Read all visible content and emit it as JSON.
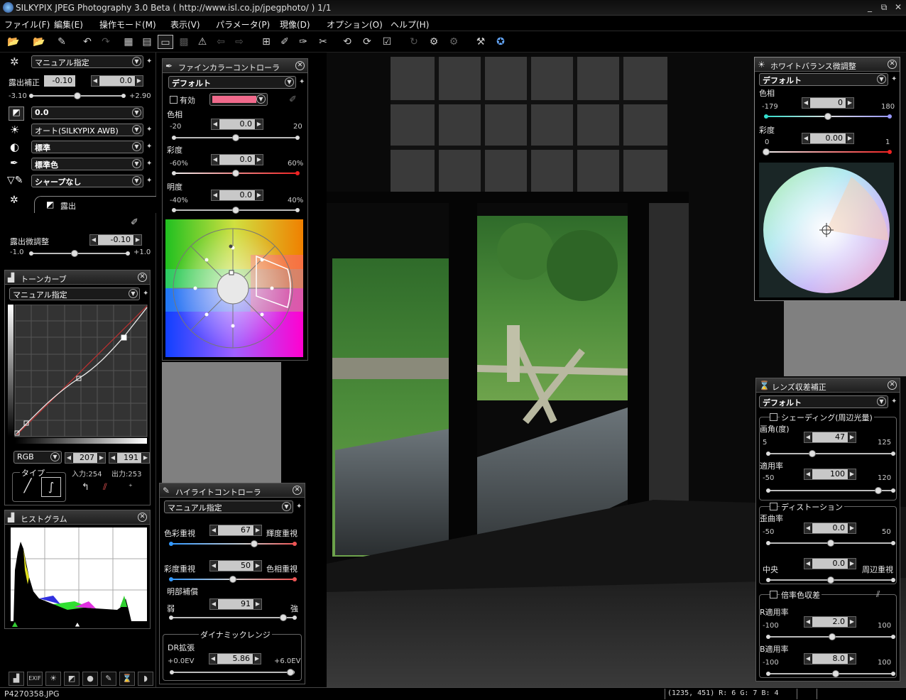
{
  "titlebar": {
    "title": "SILKYPIX JPEG Photography 3.0 Beta ( http://www.isl.co.jp/jpegphoto/ )  1/1",
    "minimize": "_",
    "restore": "⧉",
    "close": "✕"
  },
  "menu": [
    "ファイル(F)",
    "編集(E)",
    "操作モード(M)",
    "表示(V)",
    "パラメータ(P)",
    "現像(D)",
    "オプション(O)",
    "ヘルプ(H)"
  ],
  "toolbar_icons": [
    "open-folder-icon",
    "open-folder-dropdown-icon",
    "eraser-icon",
    "undo-icon",
    "redo-icon",
    "grid-view-icon",
    "filmstrip-view-icon",
    "single-view-icon",
    "compare-view-icon",
    "warning-icon",
    "prev-icon",
    "next-icon",
    "crop-icon",
    "dropper-icon",
    "clone-icon",
    "scissors-icon",
    "rotate-left-icon",
    "rotate-right-icon",
    "check-icon",
    "refresh-icon",
    "develop-icon",
    "batch-icon",
    "hammer-icon",
    "help-icon"
  ],
  "left": {
    "top_preset": "マニュアル指定",
    "exposure_label": "露出補正",
    "exposure_value": "-0.10",
    "exposure_value2": "0.0",
    "exposure_min": "-3.10",
    "exposure_max": "+2.90",
    "exposure_pos": 0.5,
    "row_tone": "0.0",
    "row_wb": "オート(SILKYPIX AWB)",
    "row_contrast": "標準",
    "row_color": "標準色",
    "row_sharp": "シャープなし",
    "tab_exposure": "露出",
    "fine_label": "露出微調整",
    "fine_value": "-0.10",
    "fine_min": "-1.0",
    "fine_max": "+1.0",
    "fine_pos": 0.45
  },
  "tonecurve": {
    "title": "トーンカーブ",
    "preset": "マニュアル指定",
    "channel": "RGB",
    "in_value": "207",
    "out_value": "191",
    "type_label": "タイプ",
    "in_readout": "入力:254",
    "out_readout": "出力:253"
  },
  "histogram": {
    "title": "ヒストグラム"
  },
  "finecolor": {
    "title": "ファインカラーコントローラ",
    "preset": "デフォルト",
    "enabled_label": "有効",
    "swatch_color": "#f06a8c",
    "hue_label": "色相",
    "hue_value": "0.0",
    "hue_min": "-20",
    "hue_max": "20",
    "hue_pos": 0.5,
    "sat_label": "彩度",
    "sat_value": "0.0",
    "sat_min": "-60%",
    "sat_max": "60%",
    "sat_pos": 0.5,
    "bri_label": "明度",
    "bri_value": "0.0",
    "bri_min": "-40%",
    "bri_max": "40%",
    "bri_pos": 0.5
  },
  "highlight": {
    "title": "ハイライトコントローラ",
    "preset": "マニュアル指定",
    "a_left": "色彩重視",
    "a_right": "輝度重視",
    "a_value": "67",
    "a_pos": 0.67,
    "b_left": "彩度重視",
    "b_right": "色相重視",
    "b_value": "50",
    "b_pos": 0.5,
    "c_label": "明部補償",
    "c_left": "弱",
    "c_right": "強",
    "c_value": "91",
    "c_pos": 0.91,
    "dr_group": "ダイナミックレンジ",
    "dr_label": "DR拡張",
    "dr_value": "5.86",
    "dr_min": "+0.0EV",
    "dr_max": "+6.0EV",
    "dr_pos": 0.98
  },
  "whitebalance": {
    "title": "ホワイトバランス微調整",
    "preset": "デフォルト",
    "hue_label": "色相",
    "hue_value": "0",
    "hue_min": "-179",
    "hue_max": "180",
    "hue_pos": 0.5,
    "sat_label": "彩度",
    "sat_value": "0.00",
    "sat_min": "0",
    "sat_max": "1",
    "sat_pos": 0.0
  },
  "lens": {
    "title": "レンズ収差補正",
    "preset": "デフォルト",
    "shading": "シェーディング(周辺光量)",
    "angle_label": "画角(度)",
    "angle_value": "47",
    "angle_min": "5",
    "angle_max": "125",
    "angle_pos": 0.35,
    "apply_label": "適用率",
    "apply_value": "100",
    "apply_min": "-50",
    "apply_max": "120",
    "apply_pos": 0.88,
    "distortion": "ディストーション",
    "dist_label": "歪曲率",
    "dist_value": "0.0",
    "dist_min": "-50",
    "dist_max": "50",
    "dist_pos": 0.5,
    "center_left": "中央",
    "center_right": "周辺重視",
    "center_value": "0.0",
    "center_pos": 0.5,
    "chroma": "倍率色収差",
    "r_label": "R適用率",
    "r_value": "2.0",
    "r_min": "-100",
    "r_max": "100",
    "r_pos": 0.51,
    "b_label": "B適用率",
    "b_value": "8.0",
    "b_min": "-100",
    "b_max": "100",
    "b_pos": 0.54
  },
  "bottom_buttons": [
    "histogram-icon",
    "exif-icon",
    "wb-icon",
    "curve-icon",
    "color-icon",
    "highlight-icon",
    "lens-icon",
    "shield-icon"
  ],
  "status": {
    "filename": "P4270358.JPG",
    "coords": "(1235, 451) R:  6 G:  7 B:  4"
  }
}
